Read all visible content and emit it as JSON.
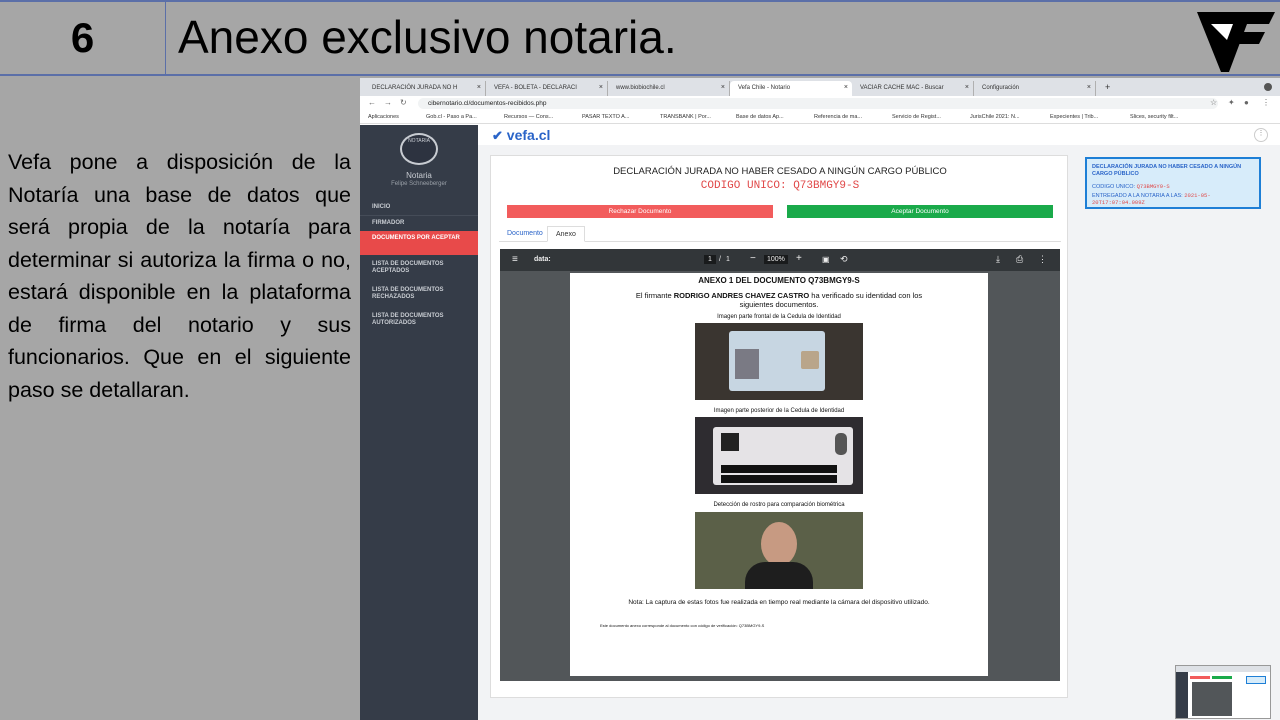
{
  "slide": {
    "number": "6",
    "title": "Anexo exclusivo notaria.",
    "body": "Vefa pone a disposición de la Notaría una base de datos que será propia de la notaría para determinar si autoriza la firma o no, estará disponible en la plataforma de firma del notario y sus funcionarios. Que en el siguiente paso se detallaran."
  },
  "browser": {
    "tabs": [
      {
        "label": "DECLARACIÓN JURADA NO H"
      },
      {
        "label": "VEFA - BOLETA - DECLARACI"
      },
      {
        "label": "www.biobiochile.cl"
      },
      {
        "label": "Vefa Chile - Notario"
      },
      {
        "label": "VACIAR CACHE MAC - Buscar"
      },
      {
        "label": "Configuración"
      }
    ],
    "new_tab": "+",
    "url": "cibernotario.cl/documentos-recibidos.php",
    "bookmarks": [
      {
        "label": "Aplicaciones"
      },
      {
        "label": "Gob.cl - Paso a Pa..."
      },
      {
        "label": "Recursos — Cons..."
      },
      {
        "label": "PASAR TEXTO A..."
      },
      {
        "label": "TRANSBANK | Por..."
      },
      {
        "label": "Base de datos Ap..."
      },
      {
        "label": "Referencia de ma..."
      },
      {
        "label": "Servicio de Regist..."
      },
      {
        "label": "JurisChile 2021: N..."
      },
      {
        "label": "Expecientes | Trib..."
      },
      {
        "label": "Slices, security filt..."
      }
    ]
  },
  "sidebar": {
    "seal_text": "NOTARIA",
    "notaria": "Notaria",
    "notario": "Felipe Schneeberger",
    "items": [
      {
        "label": "INICIO"
      },
      {
        "label": "FIRMADOR"
      },
      {
        "label": "DOCUMENTOS POR ACEPTAR"
      },
      {
        "label": "LISTA DE DOCUMENTOS ACEPTADOS"
      },
      {
        "label": "LISTA DE DOCUMENTOS RECHAZADOS"
      },
      {
        "label": "LISTA DE DOCUMENTOS AUTORIZADOS"
      }
    ]
  },
  "app": {
    "logo": "vefa.cl",
    "doc_title": "DECLARACIÓN JURADA NO HABER CESADO A NINGÚN CARGO PÚBLICO",
    "doc_code": "CODIGO UNICO: Q73BMGY9-S",
    "reject_label": "Rechazar Documento",
    "accept_label": "Aceptar Documento",
    "tab_documento": "Documento",
    "tab_anexo": "Anexo"
  },
  "viewer": {
    "filename": "data:",
    "page_current": "1",
    "page_sep": "/",
    "page_total": "1",
    "zoom": "100%",
    "page": {
      "heading": "ANEXO 1 DEL DOCUMENTO Q73BMGY9-S",
      "signer_prefix": "El firmante",
      "signer_name": "RODRIGO ANDRES CHAVEZ CASTRO",
      "signer_suffix": "ha verificado su identidad con los siguientes documentos.",
      "cap_front": "Imagen parte frontal de la Cedula de Identidad",
      "cap_back": "Imagen parte posterior de la Cedula de Identidad",
      "cap_face": "Detección de rostro para comparación biométrica",
      "note": "Nota: La captura de estas fotos fue realizada en tiempo real mediante la cámara del dispositivo utilizado.",
      "footer": "Este documento anexo corresponde al documento con código de verificación: Q73BMGY9-S"
    }
  },
  "right_card": {
    "title": "DECLARACIÓN JURADA NO HABER CESADO A NINGÚN CARGO PÚBLICO",
    "code_label": "CODIGO UNICO:",
    "code_value": "Q73BMGY9-S",
    "entered_label": "ENTREGADO A LA NOTARIA A LAS:",
    "entered_value": "2021-05-20T17:07:04.009Z"
  },
  "colors": {
    "accent_blue": "#2a64c8",
    "reject": "#f25c5c",
    "accept": "#1aaa4a",
    "sidebar_bg": "#353c48",
    "active_item": "#e84a4a"
  }
}
